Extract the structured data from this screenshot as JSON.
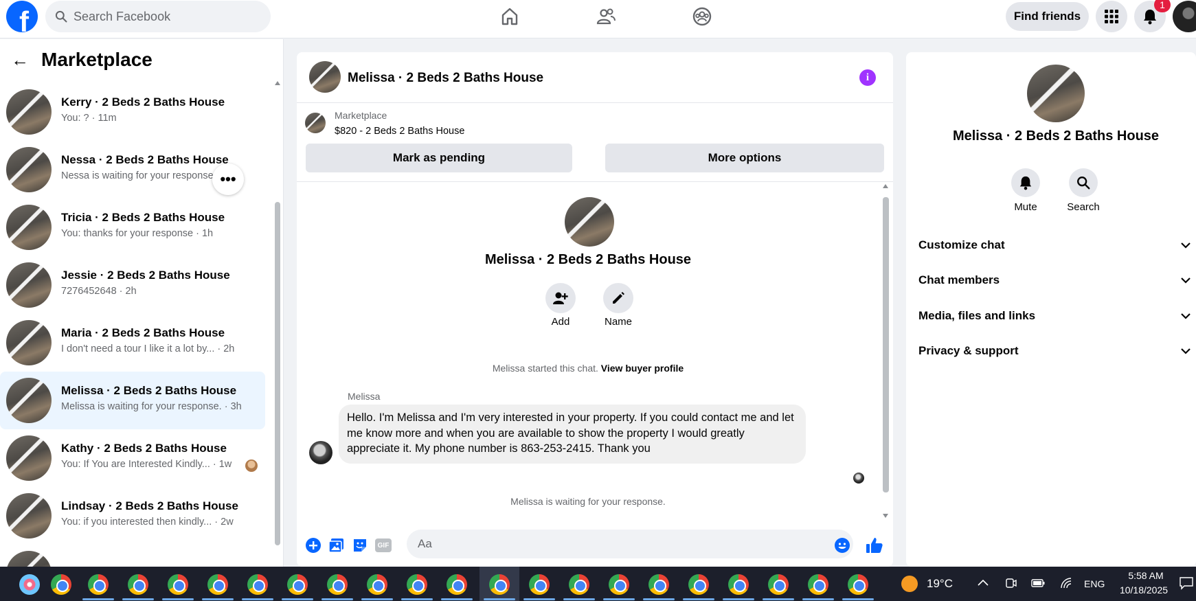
{
  "topbar": {
    "logo_letter": "f",
    "search_placeholder": "Search Facebook",
    "find_friends": "Find friends",
    "notification_count": "1"
  },
  "sidebar": {
    "back_arrow": "←",
    "title": "Marketplace",
    "items": [
      {
        "name": "Kerry · 2 Beds 2 Baths House",
        "preview": "You: ? · 11m"
      },
      {
        "name": "Nessa · 2 Beds 2 Baths House",
        "preview": "Nessa is waiting for your response. · 1h"
      },
      {
        "name": "Tricia · 2 Beds 2 Baths House",
        "preview": "You: thanks for your response · 1h"
      },
      {
        "name": "Jessie · 2 Beds 2 Baths House",
        "preview": "7276452648 · 2h"
      },
      {
        "name": "Maria · 2 Beds 2 Baths House",
        "preview": "I don't need a tour I like it a lot by... · 2h"
      },
      {
        "name": "Melissa · 2 Beds 2 Baths House",
        "preview": "Melissa is waiting for your response. · 3h"
      },
      {
        "name": "Kathy · 2 Beds 2 Baths House",
        "preview": "You: If You are Interested Kindly... · 1w"
      },
      {
        "name": "Lindsay · 2 Beds 2 Baths House",
        "preview": "You: if you interested then kindly... · 2w"
      }
    ],
    "more_dots": "•••"
  },
  "chat": {
    "header_title": "Melissa · 2 Beds 2 Baths House",
    "info_glyph": "i",
    "listing_category": "Marketplace",
    "listing_price_title": "$820 - 2 Beds 2 Baths House",
    "mark_pending": "Mark as pending",
    "more_options": "More options",
    "profile_name": "Melissa · 2 Beds 2 Baths House",
    "add_label": "Add",
    "name_label": "Name",
    "started_text": "Melissa started this chat.",
    "view_buyer_profile": "View buyer profile",
    "sender": "Melissa",
    "message": "Hello. I'm Melissa and I'm very interested in your property. If you could contact me and let me know more and when you are available to show the property I would greatly appreciate it. My phone number is 863-253-2415. Thank you",
    "waiting": "Melissa is waiting for your response.",
    "composer_placeholder": "Aa",
    "gif_label": "GIF"
  },
  "info_panel": {
    "title": "Melissa · 2 Beds 2 Baths House",
    "mute_label": "Mute",
    "search_label": "Search",
    "sections": [
      "Customize chat",
      "Chat members",
      "Media, files and links",
      "Privacy & support"
    ]
  },
  "taskbar": {
    "temperature": "19°C",
    "language": "ENG",
    "time": "5:58 AM",
    "date": "10/18/2025"
  },
  "colors": {
    "facebook_blue": "#0866ff",
    "messenger_purple": "#a033ff",
    "active_row": "#ebf5ff",
    "badge_red": "#e41e3f"
  }
}
